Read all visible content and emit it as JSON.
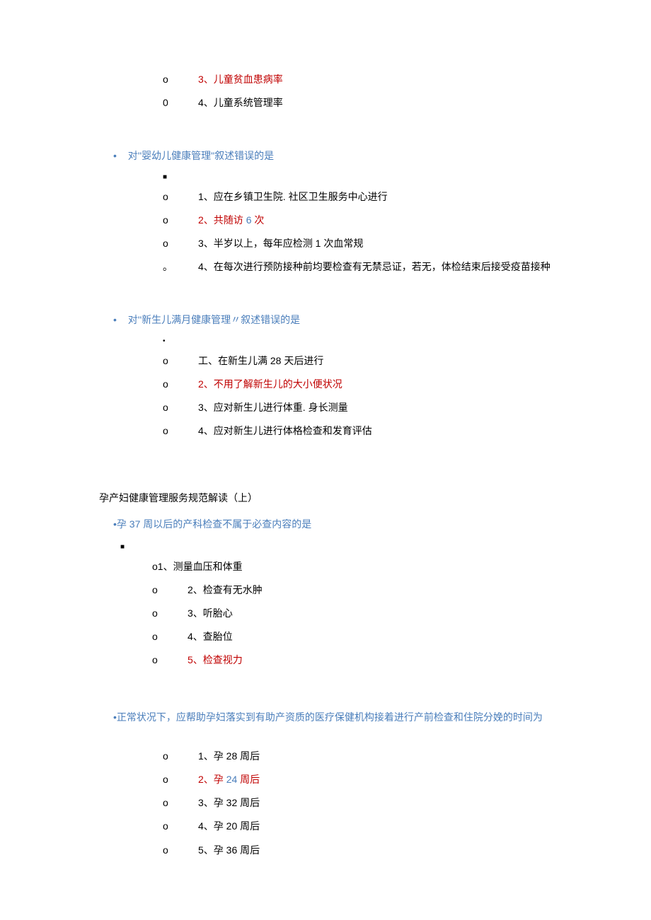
{
  "blockA": {
    "opt3": "3、儿童贫血患病率",
    "opt4": "4、儿童系统管理率"
  },
  "q2": {
    "title_pre": "对",
    "title_quote": "''婴幼儿健康管理\"",
    "title_post": "叙述错误的是",
    "opt1": "1、应在乡镇卫生院. 社区卫生服务中心进行",
    "opt2_pre": "2、共随访 ",
    "opt2_num": "6",
    "opt2_post": " 次",
    "opt3": "3、半岁以上，每年应检测 1 次血常规",
    "opt4": "4、在每次进行预防接种前均要检查有无禁忌证，若无，体检结束后接受疫苗接种"
  },
  "q3": {
    "title_pre": "对",
    "title_quote": "''新生儿满月健康管理〃",
    "title_post": "叙述错误的是",
    "opt1": "工、在新生儿满 28 天后进行",
    "opt2": "2、不用了解新生儿的大小便状况",
    "opt3": "3、应对新生儿进行体重. 身长测量",
    "opt4": "4、应对新生儿进行体格检查和发育评估"
  },
  "section": "孕产妇健康管理服务规范解读（上）",
  "q4": {
    "title_pre": "•孕 ",
    "title_num": "37",
    "title_post": " 周以后的产科检查不属于必查内容的是",
    "opt1": "o1、测量血压和体重",
    "opt2": "2、检查有无水肿",
    "opt3": "3、听胎心",
    "opt4": "4、查胎位",
    "opt5": "5、检查视力"
  },
  "q5": {
    "title": "•正常状况下，应帮助孕妇落实到有助产资质的医疗保健机构接着进行产前检查和住院分娩的时间为",
    "opt1": "1、孕 28 周后",
    "opt2_pre": "2、孕 ",
    "opt2_num": "24",
    "opt2_post": " 周后",
    "opt3": "3、孕 32 周后",
    "opt4": "4、孕 20 周后",
    "opt5": "5、孕 36 周后"
  }
}
